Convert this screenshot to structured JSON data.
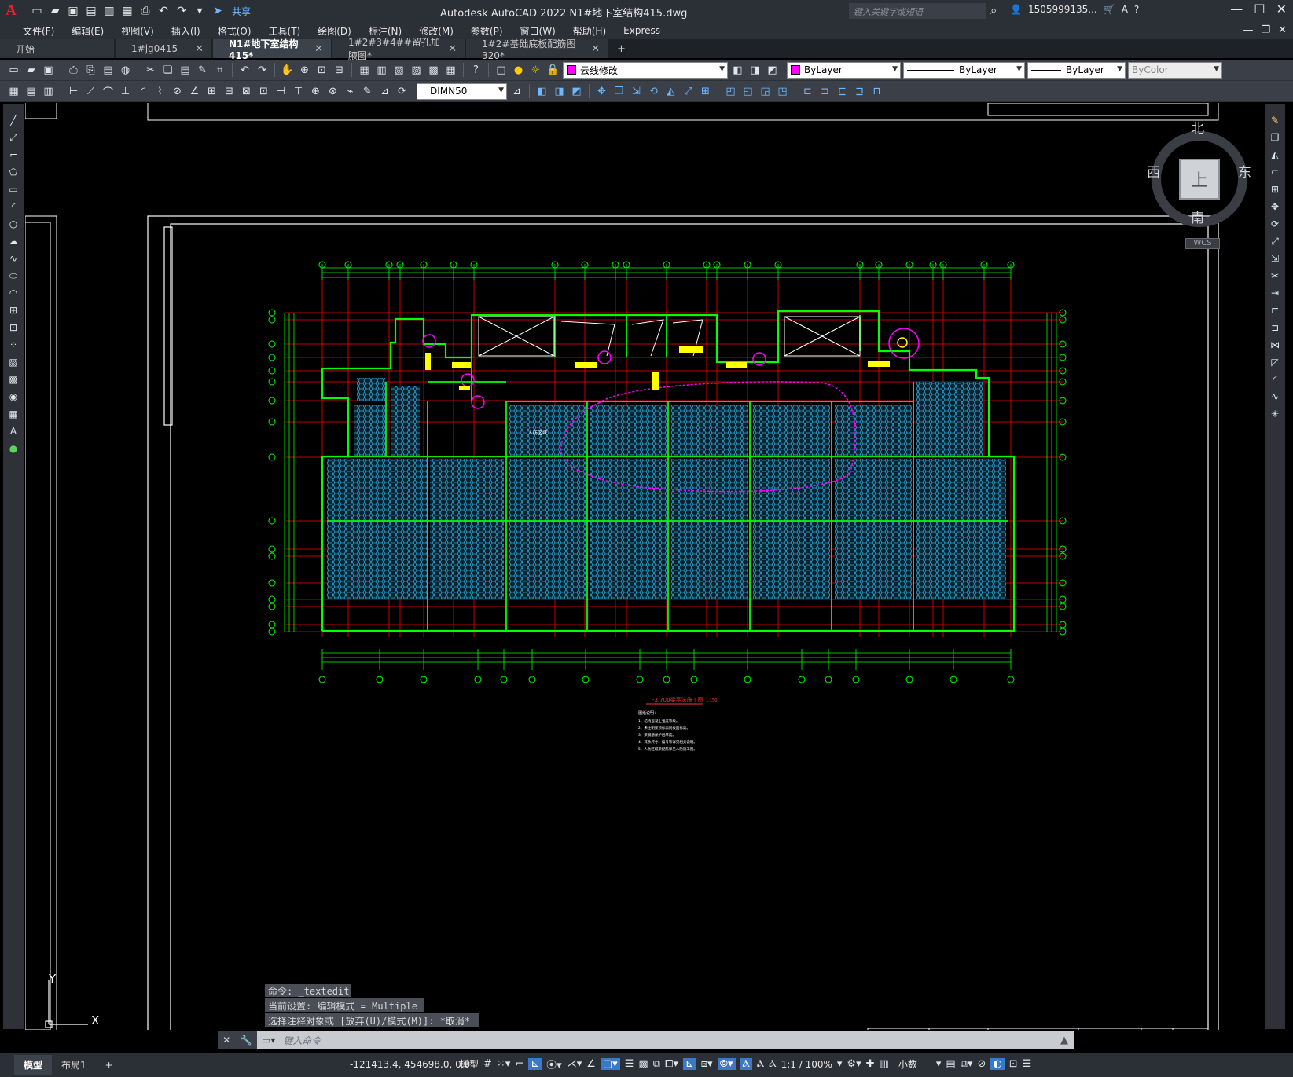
{
  "app": {
    "logo": "A",
    "title": "Autodesk AutoCAD 2022    N1#地下室结构415.dwg",
    "share": "共享",
    "search_placeholder": "键入关键字或短语",
    "user": "1505999135...",
    "window_controls": [
      "—",
      "☐",
      "✕"
    ]
  },
  "menu": {
    "items": [
      "文件(F)",
      "编辑(E)",
      "视图(V)",
      "插入(I)",
      "格式(O)",
      "工具(T)",
      "绘图(D)",
      "标注(N)",
      "修改(M)",
      "参数(P)",
      "窗口(W)",
      "帮助(H)",
      "Express"
    ]
  },
  "tabs": [
    {
      "label": "开始",
      "active": false,
      "closable": false
    },
    {
      "label": "1#jg0415",
      "active": false,
      "closable": true
    },
    {
      "label": "N1#地下室结构415*",
      "active": true,
      "closable": true
    },
    {
      "label": "1#2#3#4##留孔加腋图*",
      "active": false,
      "closable": true
    },
    {
      "label": "1#2#基础底板配筋图320*",
      "active": false,
      "closable": true
    }
  ],
  "toolbar": {
    "layer": "云线修改",
    "color": "ByLayer",
    "linetype": "ByLayer",
    "lineweight": "ByLayer",
    "plotstyle": "ByColor",
    "dimstyle": "DIMN50",
    "layer_color": "#ff00ff"
  },
  "viewcube": {
    "north": "北",
    "south": "南",
    "east": "东",
    "west": "西",
    "face": "上",
    "wcs": "WCS"
  },
  "drawing": {
    "plan_title": "-3.700梁平法施工图",
    "scale_note": "1:150",
    "notes_title": "图纸说明：",
    "notes": [
      "1、结构混凝土强度等级。",
      "2、未注明梁顶标高同板面标高。",
      "3、梁钢筋保护层厚度。",
      "4、其余尺寸、编号等详见相关说明。",
      "5、人防区域梁配筋详见人防施工图。"
    ],
    "label_room": "人防区域"
  },
  "ucs": {
    "x": "X",
    "y": "Y"
  },
  "command": {
    "history": [
      "命令: _textedit",
      "当前设置: 编辑模式 = Multiple",
      "选择注释对象或 [放弃(U)/模式(M)]: *取消*"
    ],
    "prompt": "键入命令"
  },
  "status": {
    "layouts": [
      "模型",
      "布局1"
    ],
    "add_layout": "+",
    "coords": "-121413.4, 454698.0, 0.0",
    "space": "模型",
    "scale": "1:1 / 100%",
    "units": "小数"
  },
  "colors": {
    "green": "#00ff00",
    "red": "#ff0000",
    "cyan_fill": "#2ba7d6",
    "magenta": "#ff00ff",
    "yellow": "#ffff00",
    "white": "#ffffff"
  }
}
